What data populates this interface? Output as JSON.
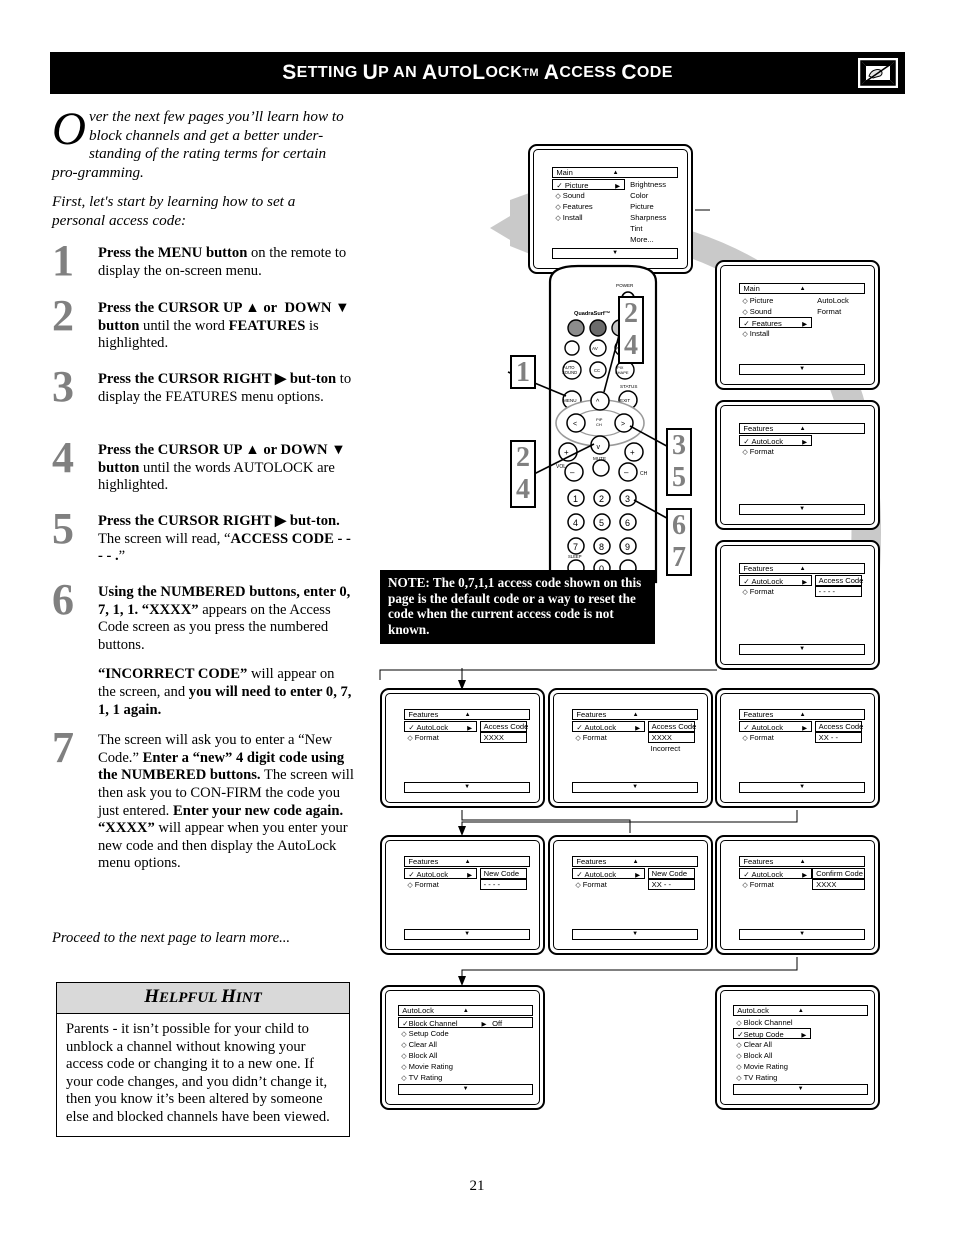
{
  "header": {
    "title_parts": [
      "S",
      "ETTING ",
      "U",
      "P AN ",
      "A",
      "UTO",
      "L",
      "OCK",
      "TM",
      " A",
      "CCESS ",
      "C",
      "ODE"
    ],
    "title_text": "Setting Up an AutoLock™ Access Code",
    "icon": "hand-pointer-tv-icon"
  },
  "intro": {
    "dropcap": "O",
    "paragraph1": "ver the next few pages you'll learn how to block channels and get a better understanding of the rating terms for certain programming.",
    "paragraph1_rest": "ver the next few pages you'll learn how to block channels and get a better under-standing of the rating terms for certain pro-gramming.",
    "paragraph2": "First, let's start by learning how to set a personal access code:"
  },
  "steps": [
    {
      "num": "1",
      "html": "<b>Press the MENU button</b> on the remote to display the on-screen menu."
    },
    {
      "num": "2",
      "html": "<b>Press the CURSOR UP ▲ or  DOWN ▼ button</b> until the word <b>FEATURES</b> is highlighted."
    },
    {
      "num": "3",
      "html": "<b>Press the CURSOR RIGHT ▶ button</b> to display the FEATURES menu options."
    },
    {
      "num": "4",
      "html": "<b>Press the CURSOR UP ▲ or DOWN ▼ button</b> until the words AUTOLOCK are highlighted."
    },
    {
      "num": "5",
      "html": "<b>Press the CURSOR RIGHT ▶ button.</b> The screen will read, “<b>ACCESS CODE - - - - .</b>”"
    },
    {
      "num": "6",
      "html": "<b>Using the NUMBERED buttons, enter 0, 7, 1, 1. “XXXX”</b> appears on the Access Code screen as you press the numbered buttons.",
      "html2": "<b>“INCORRECT CODE”</b> will appear on the screen, and <b>you will need to enter 0, 7, 1, 1 again.</b>"
    },
    {
      "num": "7",
      "html": "The screen will ask you to enter a “New Code.” <b>Enter a “new” 4 digit code using the NUMBERED buttons.</b> The screen will then ask you to CONFIRM the code you just entered. <b>Enter your new code again. “XXXX”</b> will appear when you enter your new code and then display the AutoLock menu options."
    }
  ],
  "proceed_text": "Proceed to the next page to learn more...",
  "hint": {
    "title_parts": [
      "H",
      "ELPFUL ",
      "H",
      "INT"
    ],
    "title": "Helpful Hint",
    "body": "Parents - it isn’t possible for your child to unblock a channel without knowing your access code or changing it to a new one. If your code changes, and you didn’t change it, then you know it’s been altered by someone else and blocked channels have been viewed."
  },
  "note": {
    "text": "NOTE: The 0,7,1,1 access code shown on this page is the default code or a way to reset the code when the current access code is not known."
  },
  "page_number": "21",
  "remote": {
    "brand_label": "QuadraSurf™",
    "power_label": "POWER",
    "status_label": "STATUS",
    "menu_label": "MENU",
    "exit_label": "EXIT",
    "mute_label": "MUTE",
    "vol_label": "VOL",
    "ch_label": "CH",
    "sleep_label": "SLEEP",
    "av_label": "AV",
    "auto_sound_label": "AUTO SOUND",
    "numbers": [
      "1",
      "2",
      "3",
      "4",
      "5",
      "6",
      "7",
      "8",
      "9",
      "0"
    ],
    "callouts": [
      "1",
      "2",
      "4",
      "2",
      "4",
      "3",
      "5",
      "6",
      "7"
    ]
  },
  "screens": [
    {
      "id": "main-picture",
      "title": "Main",
      "rows": [
        {
          "label": "Picture",
          "selected": true,
          "check": true,
          "arrow": true
        },
        {
          "label": "Sound",
          "selected": false,
          "check": false,
          "arrow": false
        },
        {
          "label": "Features",
          "selected": false,
          "check": false,
          "arrow": false
        },
        {
          "label": "Install",
          "selected": false,
          "check": false,
          "arrow": false
        }
      ],
      "column": [
        "Brightness",
        "Color",
        "Picture",
        "Sharpness",
        "Tint",
        "More..."
      ],
      "boxed_values": []
    },
    {
      "id": "main-features",
      "title": "Main",
      "rows": [
        {
          "label": "Picture",
          "selected": false,
          "check": false,
          "arrow": false
        },
        {
          "label": "Sound",
          "selected": false,
          "check": false,
          "arrow": false
        },
        {
          "label": "Features",
          "selected": true,
          "check": true,
          "arrow": true
        },
        {
          "label": "Install",
          "selected": false,
          "check": false,
          "arrow": false
        }
      ],
      "column": [
        "AutoLock",
        "Format"
      ],
      "boxed_values": []
    },
    {
      "id": "features-autolock",
      "title": "Features",
      "rows": [
        {
          "label": "AutoLock",
          "selected": true,
          "check": true,
          "arrow": true
        },
        {
          "label": "Format",
          "selected": false,
          "check": false,
          "arrow": false
        }
      ],
      "column": [],
      "boxed_values": []
    },
    {
      "id": "access-code-empty",
      "title": "Features",
      "rows": [
        {
          "label": "AutoLock",
          "selected": true,
          "check": true,
          "arrow": true
        },
        {
          "label": "Format",
          "selected": false,
          "check": false,
          "arrow": false
        }
      ],
      "column": [],
      "boxed_values": [
        "Access Code",
        "- - - -"
      ]
    },
    {
      "id": "access-code-xxxx",
      "title": "Features",
      "rows": [
        {
          "label": "AutoLock",
          "selected": true,
          "check": true,
          "arrow": true
        },
        {
          "label": "Format",
          "selected": false,
          "check": false,
          "arrow": false
        }
      ],
      "column": [],
      "boxed_values": [
        "Access Code",
        "XXXX"
      ],
      "extra_text": ""
    },
    {
      "id": "access-code-incorrect",
      "title": "Features",
      "rows": [
        {
          "label": "AutoLock",
          "selected": true,
          "check": true,
          "arrow": true
        },
        {
          "label": "Format",
          "selected": false,
          "check": false,
          "arrow": false
        }
      ],
      "column": [],
      "boxed_values": [
        "Access Code",
        "XXXX"
      ],
      "extra_text": "Incorrect"
    },
    {
      "id": "access-code-xx",
      "title": "Features",
      "rows": [
        {
          "label": "AutoLock",
          "selected": true,
          "check": true,
          "arrow": true
        },
        {
          "label": "Format",
          "selected": false,
          "check": false,
          "arrow": false
        }
      ],
      "column": [],
      "boxed_values": [
        "Access Code",
        "XX - -"
      ],
      "extra_text": ""
    },
    {
      "id": "new-code-empty",
      "title": "Features",
      "rows": [
        {
          "label": "AutoLock",
          "selected": true,
          "check": true,
          "arrow": true
        },
        {
          "label": "Format",
          "selected": false,
          "check": false,
          "arrow": false
        }
      ],
      "column": [],
      "boxed_values": [
        "New Code",
        "- - - -"
      ],
      "extra_text": ""
    },
    {
      "id": "new-code-xx",
      "title": "Features",
      "rows": [
        {
          "label": "AutoLock",
          "selected": true,
          "check": true,
          "arrow": true
        },
        {
          "label": "Format",
          "selected": false,
          "check": false,
          "arrow": false
        }
      ],
      "column": [],
      "boxed_values": [
        "New Code",
        "XX - -"
      ],
      "extra_text": ""
    },
    {
      "id": "confirm-code",
      "title": "Features",
      "rows": [
        {
          "label": "AutoLock",
          "selected": true,
          "check": true,
          "arrow": true
        },
        {
          "label": "Format",
          "selected": false,
          "check": false,
          "arrow": false
        }
      ],
      "column": [],
      "boxed_values": [
        "Confirm Code",
        "XXXX"
      ],
      "extra_text": ""
    },
    {
      "id": "autolock-block-channel",
      "title": "AutoLock",
      "rows": [
        {
          "label": "Block Channel",
          "selected": true,
          "check": true,
          "arrow": true,
          "value": "Off"
        },
        {
          "label": "Setup Code",
          "selected": false,
          "check": false,
          "arrow": false
        },
        {
          "label": "Clear All",
          "selected": false,
          "check": false,
          "arrow": false
        },
        {
          "label": "Block All",
          "selected": false,
          "check": false,
          "arrow": false
        },
        {
          "label": "Movie Rating",
          "selected": false,
          "check": false,
          "arrow": false
        },
        {
          "label": "TV Rating",
          "selected": false,
          "check": false,
          "arrow": false
        }
      ],
      "column": [],
      "boxed_values": []
    },
    {
      "id": "autolock-setup-code",
      "title": "AutoLock",
      "rows": [
        {
          "label": "Block Channel",
          "selected": false,
          "check": false,
          "arrow": false
        },
        {
          "label": "Setup Code",
          "selected": true,
          "check": true,
          "arrow": true
        },
        {
          "label": "Clear All",
          "selected": false,
          "check": false,
          "arrow": false
        },
        {
          "label": "Block All",
          "selected": false,
          "check": false,
          "arrow": false
        },
        {
          "label": "Movie Rating",
          "selected": false,
          "check": false,
          "arrow": false
        },
        {
          "label": "TV Rating",
          "selected": false,
          "check": false,
          "arrow": false
        }
      ],
      "column": [],
      "boxed_values": []
    }
  ]
}
